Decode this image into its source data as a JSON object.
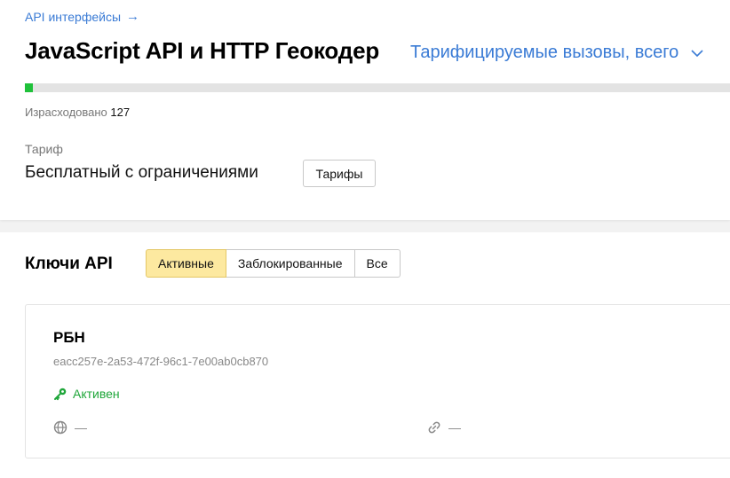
{
  "breadcrumb": {
    "label": "API интерфейсы",
    "arrow": "→"
  },
  "header": {
    "title": "JavaScript API и HTTP Геокодер",
    "metric_selector": "Тарифицируемые вызовы, всего"
  },
  "usage": {
    "label": "Израсходовано",
    "value": "127",
    "progress_fraction": 0.011,
    "bar_color": "#1fc13a"
  },
  "tariff": {
    "label": "Тариф",
    "value": "Бесплатный с ограничениями",
    "button_label": "Тарифы"
  },
  "keys": {
    "title": "Ключи API",
    "filters": [
      {
        "label": "Активные",
        "active": true
      },
      {
        "label": "Заблокированные",
        "active": false
      },
      {
        "label": "Все",
        "active": false
      }
    ],
    "items": [
      {
        "name": "РБН",
        "key": "eacc257e-2a53-472f-96c1-7e00ab0cb870",
        "status": "Активен",
        "status_icon": "key-icon",
        "status_color": "#1fa63a",
        "domains": "—",
        "domains_icon": "globe-icon",
        "links": "—",
        "links_icon": "link-icon"
      }
    ]
  },
  "colors": {
    "link": "#3a7bd5",
    "active_filter_bg": "#fde9a0",
    "page_bg": "#f2f2f2"
  }
}
